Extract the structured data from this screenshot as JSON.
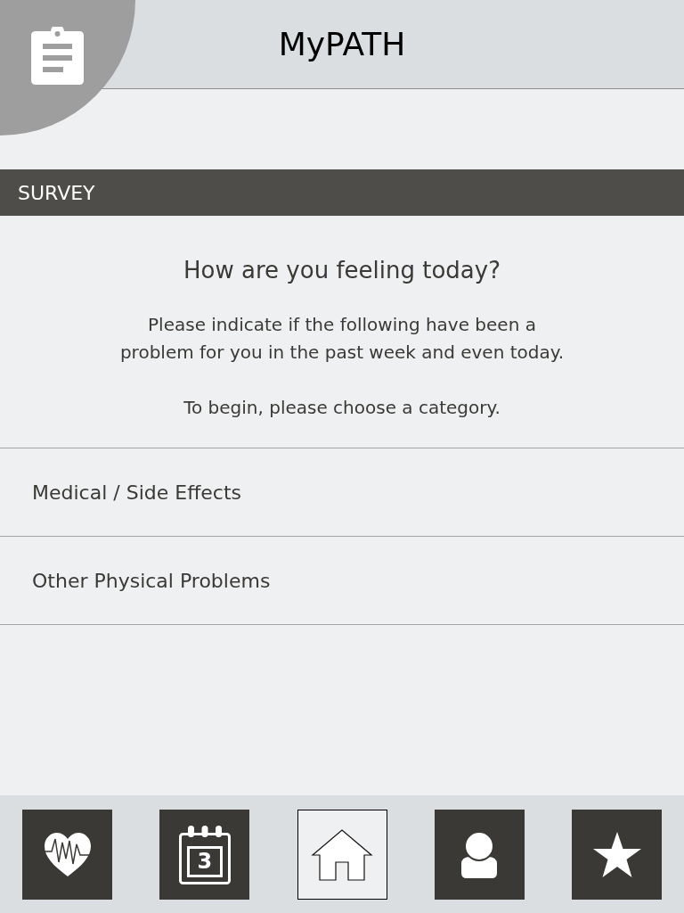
{
  "header": {
    "title": "MyPATH"
  },
  "section": {
    "title": "SURVEY"
  },
  "intro": {
    "heading": "How are you feeling today?",
    "lines": [
      "Please indicate if the following have been a",
      "problem for you in the past week and even today."
    ],
    "prompt": "To begin, please choose a category."
  },
  "categories": [
    {
      "label": "Medical / Side Effects"
    },
    {
      "label": "Other Physical Problems"
    }
  ],
  "tabs": [
    {
      "kind": "health",
      "selected": false
    },
    {
      "kind": "calendar",
      "date": "3",
      "selected": false
    },
    {
      "kind": "home",
      "selected": true
    },
    {
      "kind": "profile",
      "selected": false
    },
    {
      "kind": "favorites",
      "selected": false
    }
  ]
}
